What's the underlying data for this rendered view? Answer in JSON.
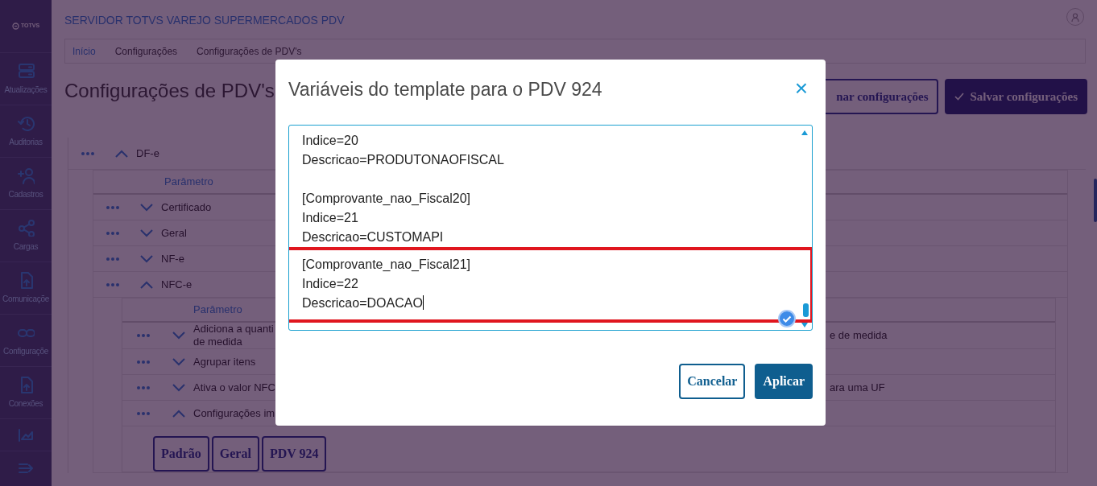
{
  "sidebar": {
    "logo": "TOTVS",
    "items": [
      {
        "label": "Atualizações"
      },
      {
        "label": "Auditorias"
      },
      {
        "label": "Cadastros"
      },
      {
        "label": "Cargas"
      },
      {
        "label": "Comunicaçõe"
      },
      {
        "label": "Configuraçõe"
      },
      {
        "label": "Conexões"
      }
    ]
  },
  "header": {
    "app_title": "SERVIDOR TOTVS VAREJO SUPERMERCADOS PDV"
  },
  "breadcrumb": [
    "Início",
    "Configurações",
    "Configurações de PDV's"
  ],
  "page_title": "Configurações de PDV's",
  "actions": [
    {
      "label": "nar configurações",
      "kind": "outline"
    },
    {
      "label": "Salvar configurações",
      "kind": "primary"
    }
  ],
  "tree": [
    {
      "label": "DF-e",
      "expanded": true,
      "header": "Parâmetro",
      "children": [
        {
          "label": "Certificado",
          "expanded": false
        },
        {
          "label": "Geral",
          "expanded": false
        },
        {
          "label": "NF-e",
          "expanded": false
        },
        {
          "label": "NFC-e",
          "expanded": true,
          "header": "Parâmetro",
          "children": [
            {
              "label": "Adiciona a quanti\nde medida",
              "value": "e de medida",
              "expanded": false
            },
            {
              "label": "Agrupar itens",
              "expanded": false
            },
            {
              "label": "Ativa o valor NFC",
              "value": "ara uma UF",
              "expanded": false
            },
            {
              "label": "Configurações im",
              "expanded": true,
              "options": [
                "Padrão",
                "Geral",
                "PDV 924"
              ]
            }
          ]
        }
      ]
    }
  ],
  "modal": {
    "title": "Variáveis do template para o PDV 924",
    "close": "×",
    "editor_blocks": [
      {
        "highlighted": false,
        "lines": [
          "Indice=20",
          "Descricao=PRODUTONAOFISCAL"
        ]
      },
      {
        "highlighted": false,
        "lines": [
          "[Comprovante_nao_Fiscal20]",
          "Indice=21",
          "Descricao=CUSTOMAPI"
        ]
      },
      {
        "highlighted": true,
        "lines": [
          "[Comprovante_nao_Fiscal21]",
          "Indice=22",
          "Descricao=DOACAO"
        ]
      }
    ],
    "buttons": [
      {
        "label": "Cancelar",
        "kind": "outline"
      },
      {
        "label": "Aplicar",
        "kind": "primary"
      }
    ]
  }
}
